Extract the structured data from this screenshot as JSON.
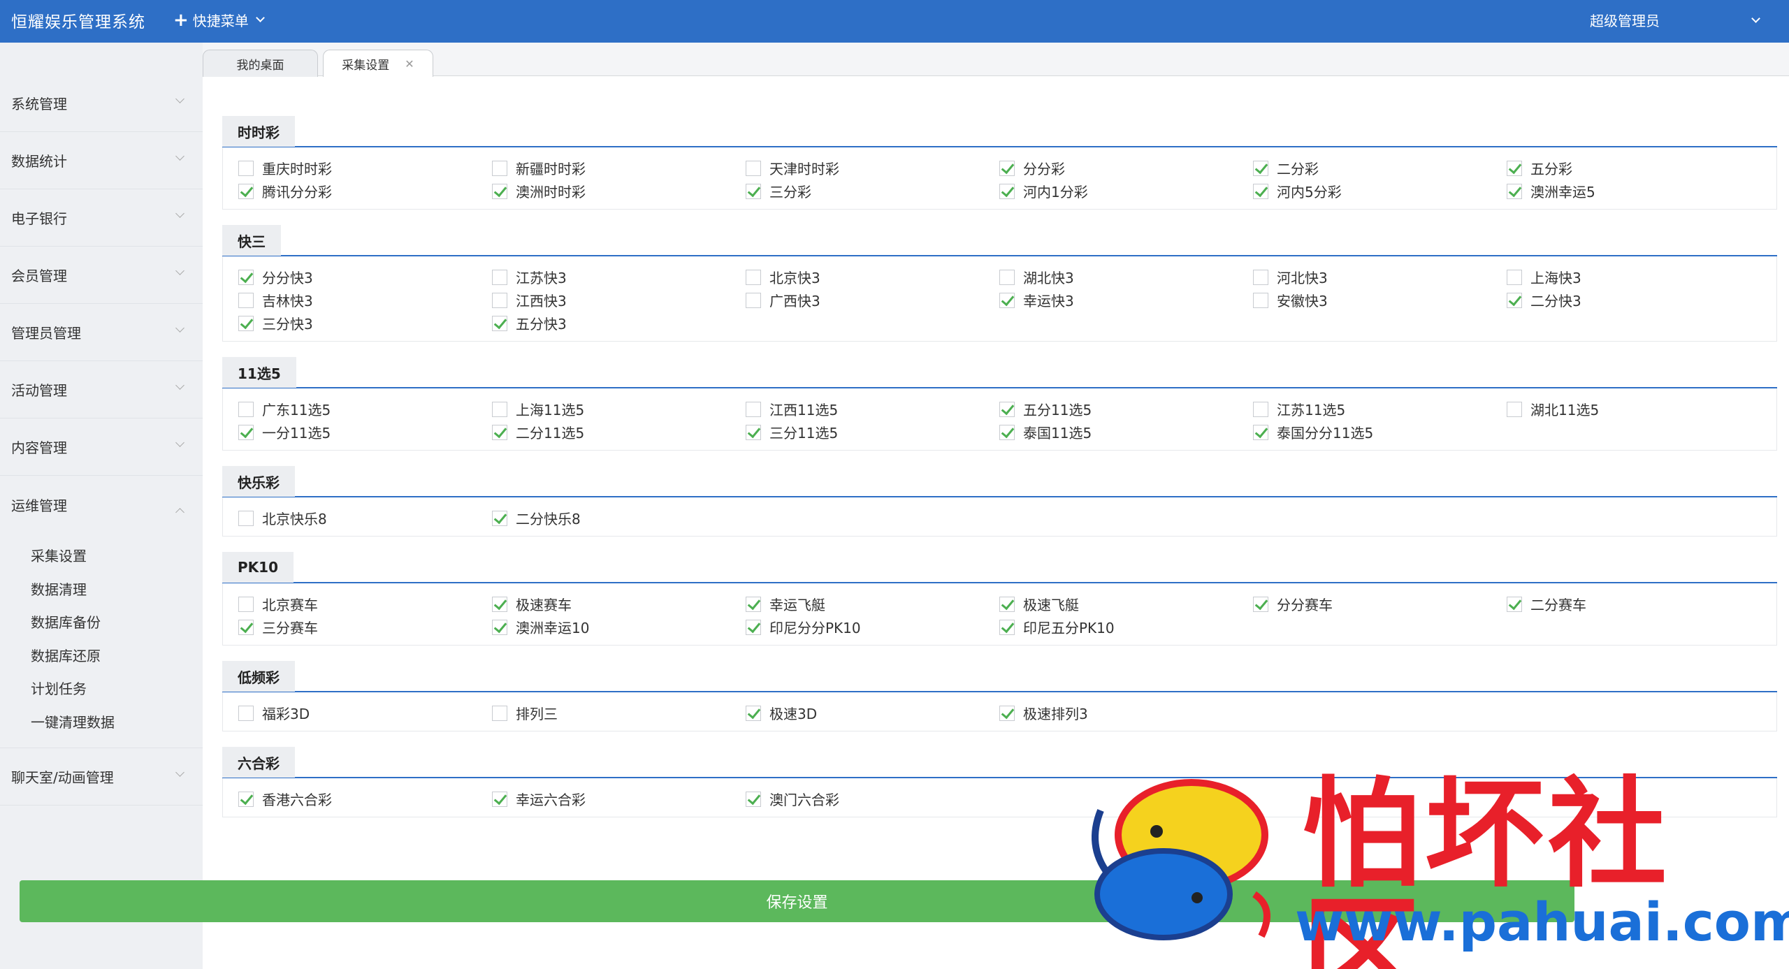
{
  "topbar": {
    "app_title": "恒耀娱乐管理系统",
    "quick_menu": "快捷菜单",
    "user": "超级管理员"
  },
  "sidebar": {
    "items": [
      {
        "label": "系统管理"
      },
      {
        "label": "数据统计"
      },
      {
        "label": "电子银行"
      },
      {
        "label": "会员管理"
      },
      {
        "label": "管理员管理"
      },
      {
        "label": "活动管理"
      },
      {
        "label": "内容管理"
      },
      {
        "label": "运维管理",
        "expanded": true
      }
    ],
    "subitems": [
      "采集设置",
      "数据清理",
      "数据库备份",
      "数据库还原",
      "计划任务",
      "一键清理数据"
    ],
    "last_item": "聊天室/动画管理"
  },
  "tabs": [
    {
      "label": "我的桌面"
    },
    {
      "label": "采集设置",
      "active": true
    }
  ],
  "sections": [
    {
      "title": "时时彩",
      "items": [
        {
          "label": "重庆时时彩",
          "checked": false
        },
        {
          "label": "新疆时时彩",
          "checked": false
        },
        {
          "label": "天津时时彩",
          "checked": false
        },
        {
          "label": "分分彩",
          "checked": true
        },
        {
          "label": "二分彩",
          "checked": true
        },
        {
          "label": "五分彩",
          "checked": true
        },
        {
          "label": "腾讯分分彩",
          "checked": true
        },
        {
          "label": "澳洲时时彩",
          "checked": true
        },
        {
          "label": "三分彩",
          "checked": true
        },
        {
          "label": "河内1分彩",
          "checked": true
        },
        {
          "label": "河内5分彩",
          "checked": true
        },
        {
          "label": "澳洲幸运5",
          "checked": true
        }
      ]
    },
    {
      "title": "快三",
      "items": [
        {
          "label": "分分快3",
          "checked": true
        },
        {
          "label": "江苏快3",
          "checked": false
        },
        {
          "label": "北京快3",
          "checked": false
        },
        {
          "label": "湖北快3",
          "checked": false
        },
        {
          "label": "河北快3",
          "checked": false
        },
        {
          "label": "上海快3",
          "checked": false
        },
        {
          "label": "吉林快3",
          "checked": false
        },
        {
          "label": "江西快3",
          "checked": false
        },
        {
          "label": "广西快3",
          "checked": false
        },
        {
          "label": "幸运快3",
          "checked": true
        },
        {
          "label": "安徽快3",
          "checked": false
        },
        {
          "label": "二分快3",
          "checked": true
        },
        {
          "label": "三分快3",
          "checked": true
        },
        {
          "label": "五分快3",
          "checked": true
        }
      ]
    },
    {
      "title": "11选5",
      "items": [
        {
          "label": "广东11选5",
          "checked": false
        },
        {
          "label": "上海11选5",
          "checked": false
        },
        {
          "label": "江西11选5",
          "checked": false
        },
        {
          "label": "五分11选5",
          "checked": true
        },
        {
          "label": "江苏11选5",
          "checked": false
        },
        {
          "label": "湖北11选5",
          "checked": false
        },
        {
          "label": "一分11选5",
          "checked": true
        },
        {
          "label": "二分11选5",
          "checked": true
        },
        {
          "label": "三分11选5",
          "checked": true
        },
        {
          "label": "泰国11选5",
          "checked": true
        },
        {
          "label": "泰国分分11选5",
          "checked": true
        }
      ]
    },
    {
      "title": "快乐彩",
      "items": [
        {
          "label": "北京快乐8",
          "checked": false
        },
        {
          "label": "二分快乐8",
          "checked": true
        }
      ]
    },
    {
      "title": "PK10",
      "items": [
        {
          "label": "北京赛车",
          "checked": false
        },
        {
          "label": "极速赛车",
          "checked": true
        },
        {
          "label": "幸运飞艇",
          "checked": true
        },
        {
          "label": "极速飞艇",
          "checked": true
        },
        {
          "label": "分分赛车",
          "checked": true
        },
        {
          "label": "二分赛车",
          "checked": true
        },
        {
          "label": "三分赛车",
          "checked": true
        },
        {
          "label": "澳洲幸运10",
          "checked": true
        },
        {
          "label": "印尼分分PK10",
          "checked": true
        },
        {
          "label": "印尼五分PK10",
          "checked": true
        }
      ]
    },
    {
      "title": "低频彩",
      "items": [
        {
          "label": "福彩3D",
          "checked": false
        },
        {
          "label": "排列三",
          "checked": false
        },
        {
          "label": "极速3D",
          "checked": true
        },
        {
          "label": "极速排列3",
          "checked": true
        }
      ]
    },
    {
      "title": "六合彩",
      "items": [
        {
          "label": "香港六合彩",
          "checked": true
        },
        {
          "label": "幸运六合彩",
          "checked": true
        },
        {
          "label": "澳门六合彩",
          "checked": true
        }
      ]
    }
  ],
  "save_button": "保存设置",
  "watermark": {
    "text": "怕坏社区",
    "url": "www.pahuai.com"
  },
  "colors": {
    "topbar": "#2e6fc6",
    "accent_line": "#2e6fc6",
    "check": "#4caf50",
    "save_button": "#5cb85c",
    "watermark_red": "#e8202a",
    "watermark_blue": "#1a6fd8"
  }
}
